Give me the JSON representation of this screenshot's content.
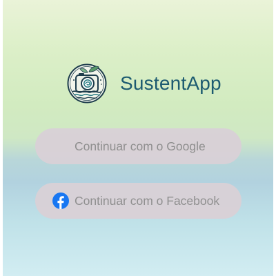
{
  "app": {
    "name": "SustentApp",
    "logo_icon": "camera-waves-leaf-icon"
  },
  "login": {
    "google_label": "Continuar com o Google",
    "facebook_label": "Continuar com o Facebook",
    "facebook_icon": "facebook-icon"
  },
  "colors": {
    "brand_text": "#1c5a70",
    "button_bg": "#d9d0d6",
    "button_text": "#8f8f8f",
    "facebook_blue": "#1877f2"
  }
}
